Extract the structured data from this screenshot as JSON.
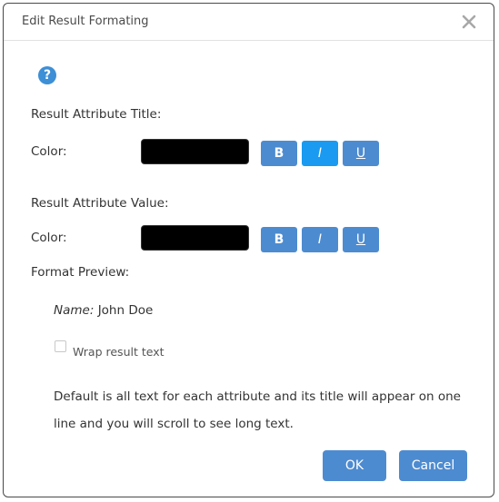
{
  "dialog": {
    "title": "Edit Result Formating",
    "close_icon": "close-icon",
    "help_icon": "question-circle-icon",
    "help_glyph": "?"
  },
  "title_section": {
    "heading": "Result Attribute Title:",
    "color_label": "Color:",
    "color_value": "#000000",
    "bold_label": "B",
    "italic_label": "I",
    "underline_label": "U",
    "italic_active": true
  },
  "value_section": {
    "heading": "Result Attribute Value:",
    "color_label": "Color:",
    "color_value": "#000000",
    "bold_label": "B",
    "italic_label": "I",
    "underline_label": "U"
  },
  "preview": {
    "heading": "Format Preview:",
    "attribute_name": "Name:",
    "attribute_value": "John Doe"
  },
  "wrap": {
    "label": "Wrap result text",
    "checked": false
  },
  "info_text": "Default is all text for each attribute and its title will appear on one line and you will scroll to see long text.",
  "actions": {
    "ok_label": "OK",
    "cancel_label": "Cancel"
  },
  "colors": {
    "button_blue": "#4d8bd0",
    "button_active": "#1a9af0",
    "help_blue": "#3d8fd6"
  }
}
